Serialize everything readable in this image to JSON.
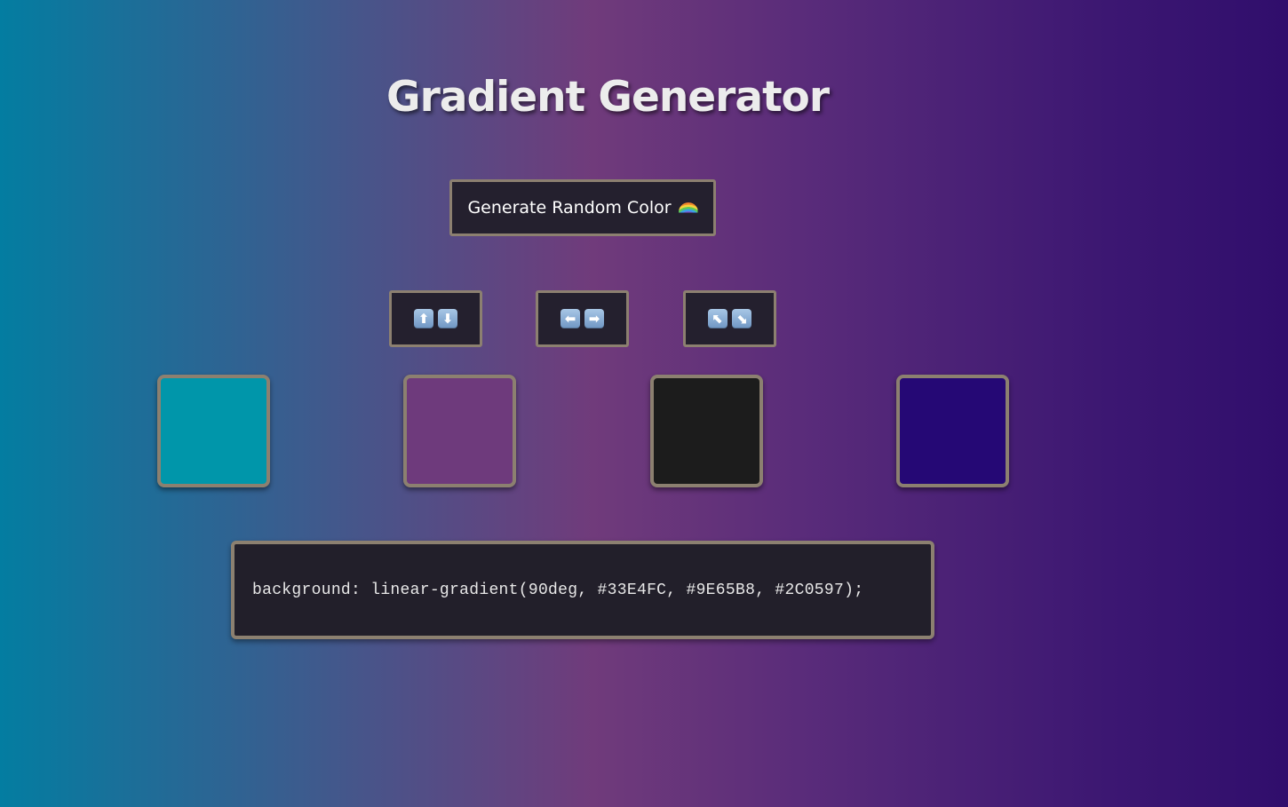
{
  "title": "Gradient Generator",
  "generate_button": {
    "label": "Generate Random Color",
    "icon": "rainbow-icon"
  },
  "direction_buttons": [
    {
      "name": "vertical",
      "icons": [
        "up-arrow-icon",
        "down-arrow-icon"
      ],
      "glyphs": [
        "⬆",
        "⬇"
      ]
    },
    {
      "name": "horizontal",
      "icons": [
        "left-arrow-icon",
        "right-arrow-icon"
      ],
      "glyphs": [
        "⬅",
        "➡"
      ]
    },
    {
      "name": "diagonal",
      "icons": [
        "up-left-arrow-icon",
        "down-right-arrow-icon"
      ],
      "glyphs": [
        "⬉",
        "⬊"
      ]
    }
  ],
  "swatches": [
    {
      "color": "#0096AA"
    },
    {
      "color": "#6E3A7C"
    },
    {
      "color": "#1C1C1C"
    },
    {
      "color": "#250875"
    }
  ],
  "css_output": "background: linear-gradient(90deg, #33E4FC, #9E65B8, #2C0597);",
  "colors": {
    "background_start": "#037da1",
    "background_mid": "#703b7b",
    "background_end": "#300e6c",
    "button_bg": "#24202e",
    "button_border": "#8c8070"
  }
}
